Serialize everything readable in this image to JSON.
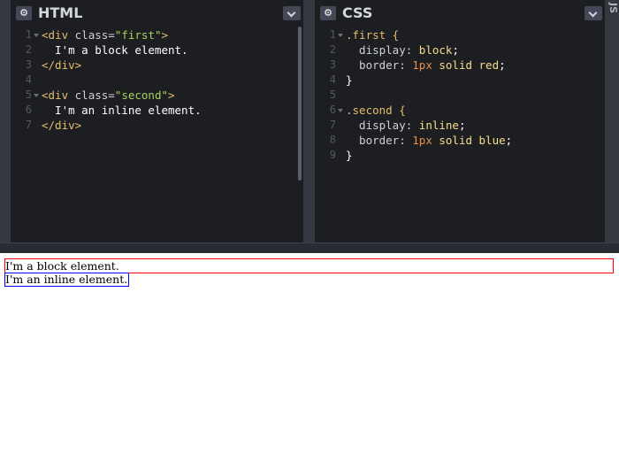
{
  "panels": {
    "html": {
      "title": "HTML",
      "line_numbers": [
        "1",
        "2",
        "3",
        "4",
        "5",
        "6",
        "7"
      ],
      "code": [
        {
          "tokens": [
            {
              "t": "<div ",
              "c": "tag"
            },
            {
              "t": "class=",
              "c": "attr"
            },
            {
              "t": "\"first\"",
              "c": "str"
            },
            {
              "t": ">",
              "c": "tag"
            }
          ]
        },
        {
          "tokens": [
            {
              "t": "  I'm a block element.",
              "c": "txt"
            }
          ]
        },
        {
          "tokens": [
            {
              "t": "</div>",
              "c": "tag"
            }
          ]
        },
        {
          "tokens": []
        },
        {
          "tokens": [
            {
              "t": "<div ",
              "c": "tag"
            },
            {
              "t": "class=",
              "c": "attr"
            },
            {
              "t": "\"second\"",
              "c": "str"
            },
            {
              "t": ">",
              "c": "tag"
            }
          ]
        },
        {
          "tokens": [
            {
              "t": "  I'm an inline element.",
              "c": "txt"
            }
          ]
        },
        {
          "tokens": [
            {
              "t": "</div>",
              "c": "tag"
            }
          ]
        }
      ]
    },
    "css": {
      "title": "CSS",
      "line_numbers": [
        "1",
        "2",
        "3",
        "4",
        "5",
        "6",
        "7",
        "8",
        "9"
      ],
      "code": [
        {
          "tokens": [
            {
              "t": ".first {",
              "c": "sel"
            }
          ]
        },
        {
          "tokens": [
            {
              "t": "  display: ",
              "c": "prop"
            },
            {
              "t": "block",
              "c": "val"
            },
            {
              "t": ";",
              "c": "txt"
            }
          ]
        },
        {
          "tokens": [
            {
              "t": "  border: ",
              "c": "prop"
            },
            {
              "t": "1px ",
              "c": "num"
            },
            {
              "t": "solid red",
              "c": "val"
            },
            {
              "t": ";",
              "c": "txt"
            }
          ]
        },
        {
          "tokens": [
            {
              "t": "}",
              "c": "txt"
            }
          ]
        },
        {
          "tokens": []
        },
        {
          "tokens": [
            {
              "t": ".second {",
              "c": "sel"
            }
          ]
        },
        {
          "tokens": [
            {
              "t": "  display: ",
              "c": "prop"
            },
            {
              "t": "inline",
              "c": "val"
            },
            {
              "t": ";",
              "c": "txt"
            }
          ]
        },
        {
          "tokens": [
            {
              "t": "  border: ",
              "c": "prop"
            },
            {
              "t": "1px ",
              "c": "num"
            },
            {
              "t": "solid blue",
              "c": "val"
            },
            {
              "t": ";",
              "c": "txt"
            }
          ]
        },
        {
          "tokens": [
            {
              "t": "}",
              "c": "txt"
            }
          ]
        }
      ]
    },
    "js": {
      "title": "JS"
    }
  },
  "preview": {
    "block_text": "I'm a block element.",
    "inline_text": "I'm an inline element."
  },
  "icons": {
    "settings": "gear-icon",
    "dropdown": "chevron-down-icon"
  },
  "colors": {
    "editor_bg": "#1d1e22",
    "chrome_bg": "#343740",
    "tag": "#e4bd6d",
    "string": "#a6d35e",
    "number": "#e58f4a",
    "block_border": "red",
    "inline_border": "blue"
  }
}
